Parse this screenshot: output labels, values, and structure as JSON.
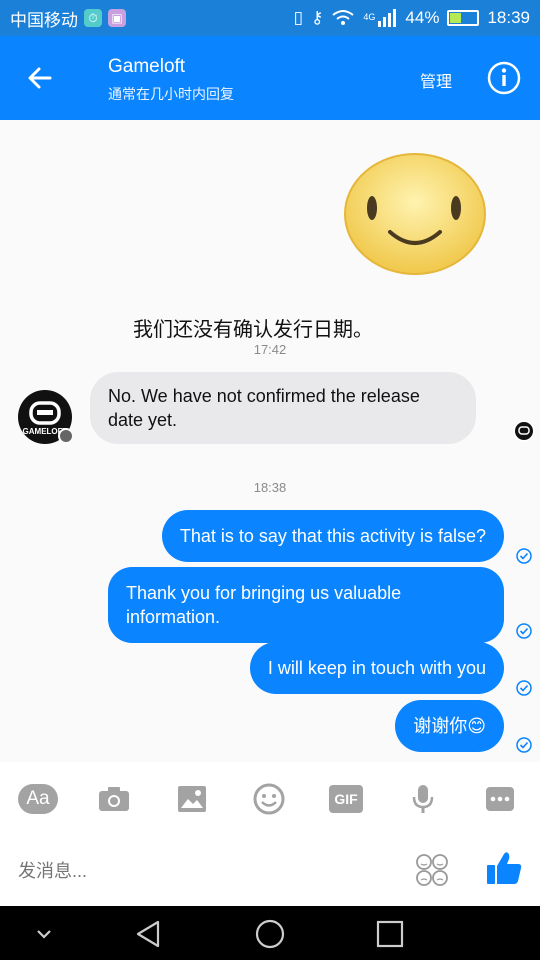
{
  "status_bar": {
    "carrier": "中国移动",
    "battery_percent": "44%",
    "battery_level": 0.44,
    "network": "4G",
    "time": "18:39"
  },
  "header": {
    "title": "Gameloft",
    "subtitle": "通常在几小时内回复",
    "manage_label": "管理"
  },
  "chat": {
    "incoming_quote": "我们还没有确认发行日期。",
    "time1": "17:42",
    "incoming_message": "No. We have not confirmed the release date yet.",
    "avatar_text": "GAMELOFT",
    "time2": "18:38",
    "outgoing": [
      "That is to say that this activity is false?",
      "Thank you for bringing us valuable information.",
      "I will keep in touch with you",
      "谢谢你😊"
    ]
  },
  "toolbar": {
    "aa_label": "Aa",
    "gif_label": "GIF"
  },
  "composer": {
    "placeholder": "发消息..."
  },
  "icons": {
    "back": "arrow-left-icon",
    "info": "info-icon",
    "camera": "camera-icon",
    "image": "image-icon",
    "emoji": "smiley-icon",
    "mic": "microphone-icon",
    "more": "more-icon",
    "like": "thumbs-up-icon",
    "check": "check-circle-icon"
  },
  "colors": {
    "brand": "#0a84ff",
    "incoming_bubble": "#e9e9eb",
    "toolbar_icon": "#a3a3a3"
  }
}
